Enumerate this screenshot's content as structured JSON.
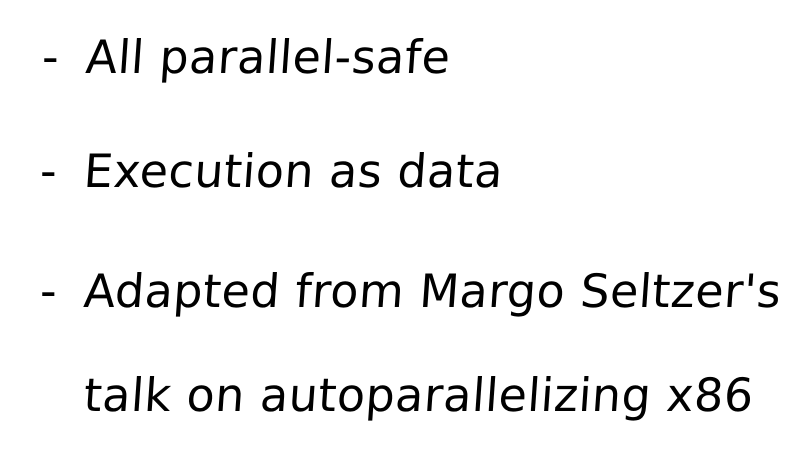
{
  "notes": {
    "lines": [
      {
        "bullet": "-",
        "text": "All parallel-safe"
      },
      {
        "bullet": "-",
        "text": "Execution as data"
      },
      {
        "bullet": "-",
        "text": "Adapted from Margo Seltzer's"
      },
      {
        "bullet": "",
        "text": "talk on autoparallelizing x86"
      }
    ]
  }
}
